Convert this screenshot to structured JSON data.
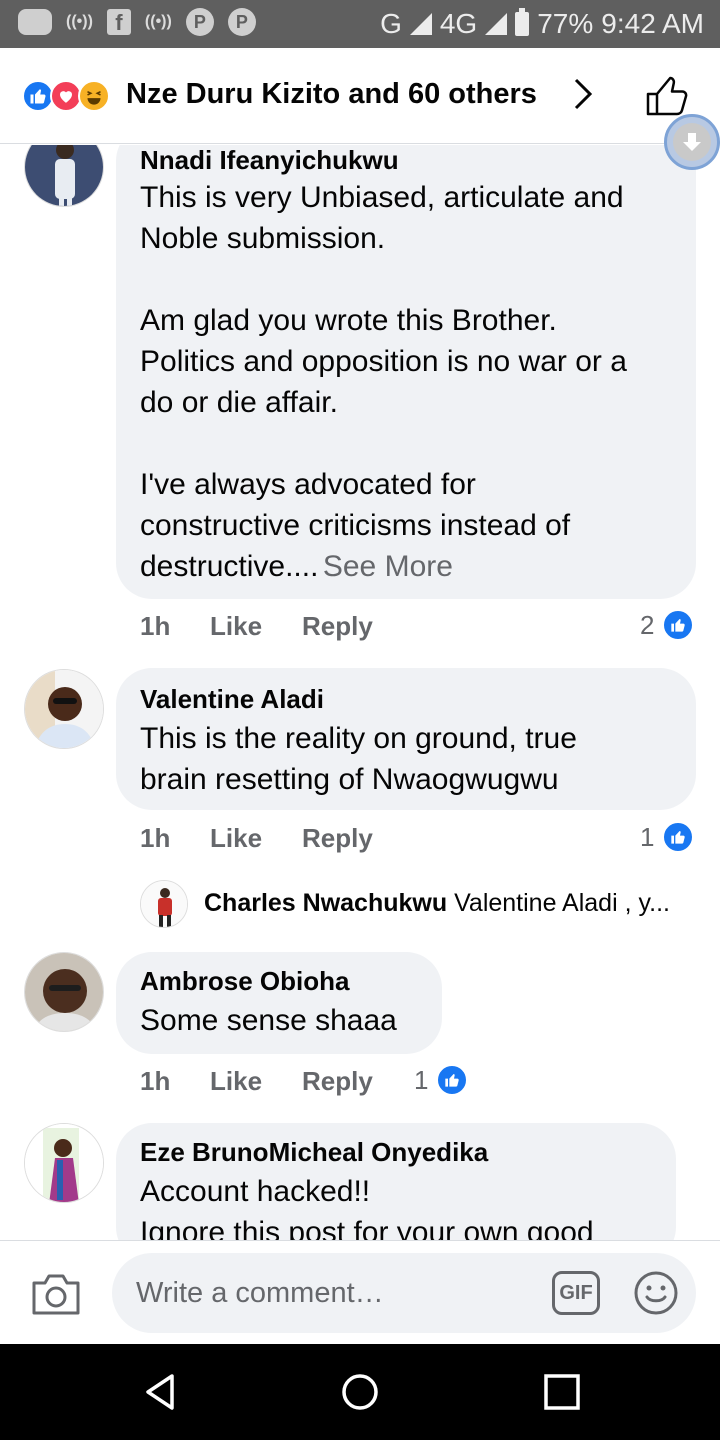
{
  "status_bar": {
    "network": "G",
    "network2": "4G",
    "battery": "77%",
    "time": "9:42 AM"
  },
  "header": {
    "title": "Nze Duru Kizito and 60 others",
    "reactions": [
      "like",
      "love",
      "haha"
    ]
  },
  "comments": [
    {
      "name": "Nnadi Ifeanyichukwu",
      "text": "This is very Unbiased, articulate and\nNoble submission.\n\nAm glad you wrote this Brother.\nPolitics and opposition is no war or a\ndo or die affair.\n\nI've always advocated for\nconstructive criticisms instead of\ndestructive....",
      "see_more": "See More",
      "time": "1h",
      "like": "Like",
      "reply": "Reply",
      "reaction_count": "2"
    },
    {
      "name": "Valentine Aladi",
      "text": "This is the reality on ground, true\nbrain resetting of Nwaogwugwu",
      "time": "1h",
      "like": "Like",
      "reply": "Reply",
      "reaction_count": "1",
      "reply_preview": {
        "name": "Charles Nwachukwu",
        "text": "Valentine Aladi , y..."
      }
    },
    {
      "name": "Ambrose Obioha",
      "text": "Some sense shaaa",
      "time": "1h",
      "like": "Like",
      "reply": "Reply",
      "reaction_count": "1"
    },
    {
      "name": "Eze BrunoMicheal Onyedika",
      "text": "Account hacked!!\nIgnore this post for your own good"
    }
  ],
  "composer": {
    "placeholder": "Write a comment…",
    "gif_label": "GIF"
  },
  "colors": {
    "facebook_blue": "#1877f2",
    "bubble_gray": "#f0f2f5",
    "secondary_text": "#65676b",
    "status_bar": "#5f5f5f"
  }
}
